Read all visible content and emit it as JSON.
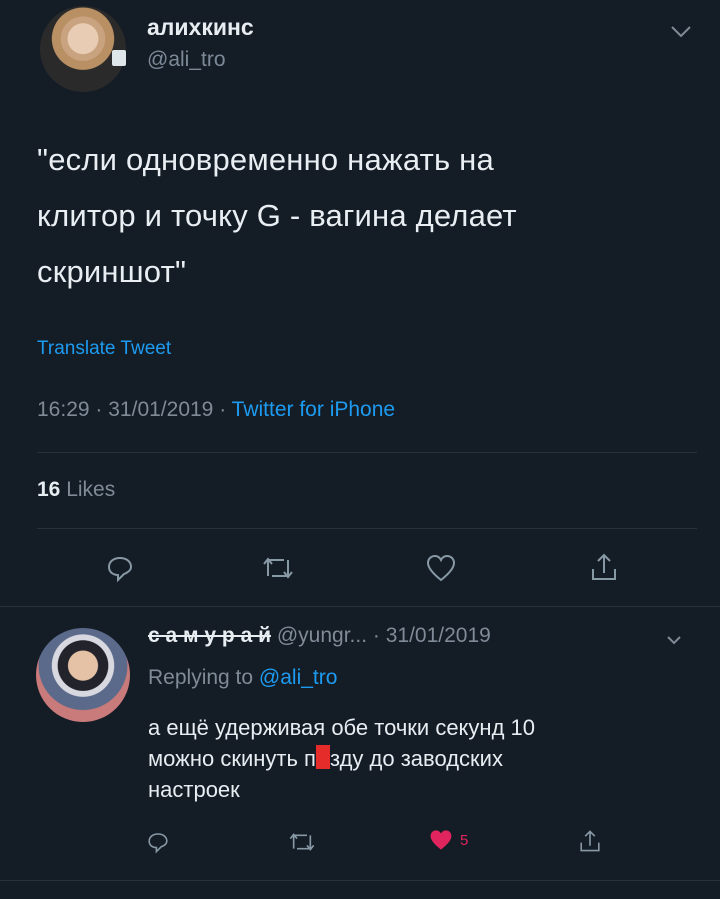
{
  "tweet": {
    "display_name": "алихкинс",
    "handle": "@ali_tro",
    "text_lines": [
      "\"если одновременно нажать на",
      "клитор и точку G - вагина делает",
      "скриншот\""
    ],
    "translate_label": "Translate Tweet",
    "time": "16:29",
    "date": "31/01/2019",
    "source": "Twitter for iPhone",
    "separator": "·",
    "likes_count": "16",
    "likes_label": "Likes"
  },
  "reply": {
    "display_name": "с а м у р а й",
    "handle": "@yungr...",
    "date": "· 31/01/2019",
    "replying_to_prefix": "Replying to",
    "replying_to_handle": "@ali_tro",
    "line1": "а ещё удерживая обе точки секунд 10",
    "line2_before": "можно скинуть п",
    "line2_after": "зду до заводских",
    "line3": "настроек",
    "like_count": "5"
  },
  "icons": {
    "reply": "reply-icon",
    "retweet": "retweet-icon",
    "like": "heart-icon",
    "share": "share-icon",
    "menu": "chevron-down-icon"
  },
  "colors": {
    "background": "#141c26",
    "link": "#1d9bf0",
    "liked": "#e0245e",
    "censor": "#e62b2b"
  }
}
